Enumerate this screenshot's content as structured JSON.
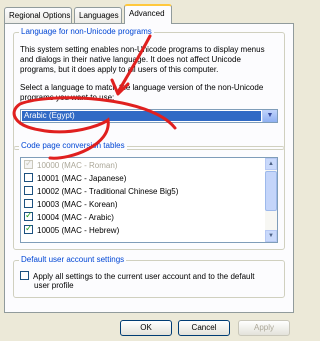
{
  "tabs": [
    {
      "label": "Regional Options"
    },
    {
      "label": "Languages"
    },
    {
      "label": "Advanced"
    }
  ],
  "nonunicode": {
    "legend": "Language for non-Unicode programs",
    "desc1": "This system setting enables non-Unicode programs to display menus",
    "desc2": "and dialogs in their native language. It does not affect Unicode",
    "desc3": "programs, but it does apply to all users of this computer.",
    "select_label1": "Select a language to match the language version of the non-Unicode",
    "select_label2": "programs you want to use:",
    "selected_language": "Arabic (Egypt)"
  },
  "codepages": {
    "legend": "Code page conversion tables",
    "items": [
      {
        "label": "10000 (MAC - Roman)",
        "checked": true,
        "disabled": true
      },
      {
        "label": "10001 (MAC - Japanese)",
        "checked": false,
        "disabled": false
      },
      {
        "label": "10002 (MAC - Traditional Chinese Big5)",
        "checked": false,
        "disabled": false
      },
      {
        "label": "10003 (MAC - Korean)",
        "checked": false,
        "disabled": false
      },
      {
        "label": "10004 (MAC - Arabic)",
        "checked": true,
        "disabled": false
      },
      {
        "label": "10005 (MAC - Hebrew)",
        "checked": true,
        "disabled": false
      }
    ]
  },
  "defaults": {
    "legend": "Default user account settings",
    "checkbox_line1": "Apply all settings to the current user account and to the default",
    "checkbox_line2": "user profile"
  },
  "buttons": {
    "ok": "OK",
    "cancel": "Cancel",
    "apply": "Apply"
  },
  "colors": {
    "annotation": "#e0201f",
    "selection": "#316ac5",
    "legend_text": "#0046d5"
  }
}
